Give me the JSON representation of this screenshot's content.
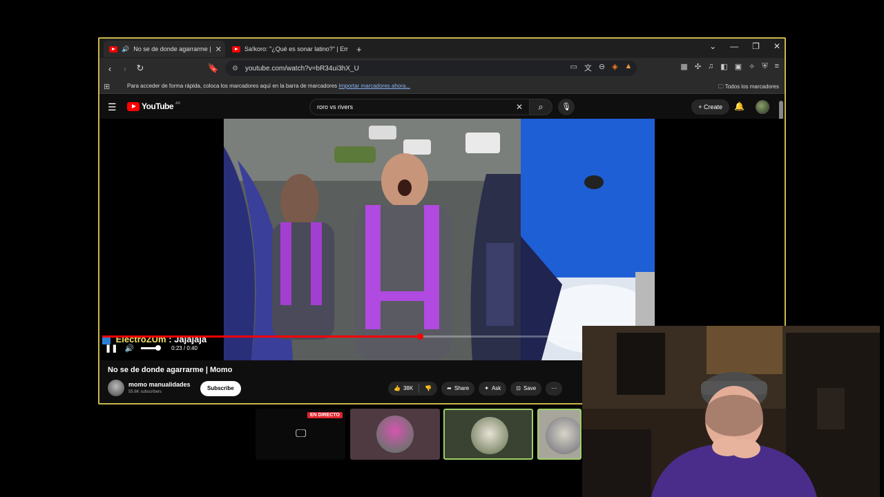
{
  "browser": {
    "tabs": [
      {
        "label": "No se de donde agarrarme | "
      },
      {
        "label": "Sa!koro: \"¿Qué es sonar latino?\" | Em"
      }
    ],
    "new_tab": "+",
    "url": "youtube.com/watch?v=bR34ui3hX_U",
    "bookmarks_msg": "Para acceder de forma rápida, coloca los marcadores aquí en la barra de marcadores",
    "bookmarks_link": "Importar marcadores ahora...",
    "bookmarks_all": "Todos los marcadores"
  },
  "youtube": {
    "logo_text": "YouTube",
    "logo_region": "AR",
    "search_query": "roro vs rivers",
    "create_label": "Create",
    "video": {
      "title": "No se de donde agarrarme | Momo",
      "current_time": "0:23 / 0:40",
      "progress": 0.575
    },
    "channel": {
      "name": "momo manualidades",
      "subs": "55.6K subscribers"
    },
    "subscribe_label": "Subscribe",
    "actions": {
      "likes": "38K",
      "share": "Share",
      "ask": "Ask",
      "save": "Save"
    }
  },
  "overlay": {
    "chat_user": "ElectroZUm",
    "chat_message": ": Jajajaja"
  },
  "thumbnails": {
    "live_badge": "EN DIRECTO"
  },
  "colors": {
    "accent": "#ff0000",
    "window_border": "#c9b84a",
    "thumb_selected_border": "#9ed16a"
  }
}
